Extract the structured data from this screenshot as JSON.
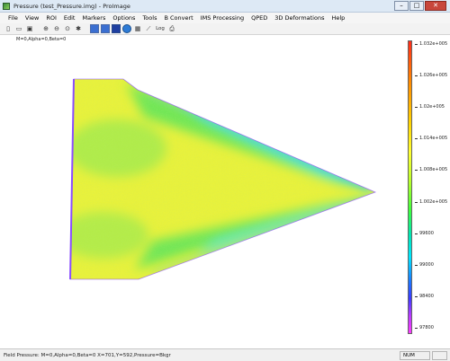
{
  "window": {
    "title": "Pressure (test_Pressure.img) - ProImage",
    "buttons": {
      "minimize": "–",
      "maximize": "□",
      "close": "✕"
    }
  },
  "menu": [
    "File",
    "View",
    "ROI",
    "Edit",
    "Markers",
    "Options",
    "Tools",
    "B Convert",
    "IMS Processing",
    "QPED",
    "3D Deformations",
    "Help"
  ],
  "toolbar": {
    "log_label": "Log"
  },
  "view": {
    "params": "M=0,Alpha=0,Beta=0"
  },
  "colorbar": {
    "labels": [
      "1.032e+005",
      "1.026e+005",
      "1.02e+005",
      "1.014e+005",
      "1.008e+005",
      "1.002e+005",
      "99600",
      "99000",
      "98400",
      "97800"
    ],
    "colors": [
      "#ff2a1a",
      "#ffd400",
      "#b8ff2a",
      "#3cff3c",
      "#00e6ff",
      "#1a7aff",
      "#ff3aff"
    ]
  },
  "status": {
    "text": "Field Pressure: M=0,Alpha=0,Beta=0  X=701,Y=592,Pressure=Bkgr",
    "num": "NUM"
  },
  "colors": {
    "field_yellow": "#eaf23a",
    "field_green": "#5fe65a",
    "field_cyan": "#4ee8e6",
    "edge_purple": "#8a4dff"
  }
}
